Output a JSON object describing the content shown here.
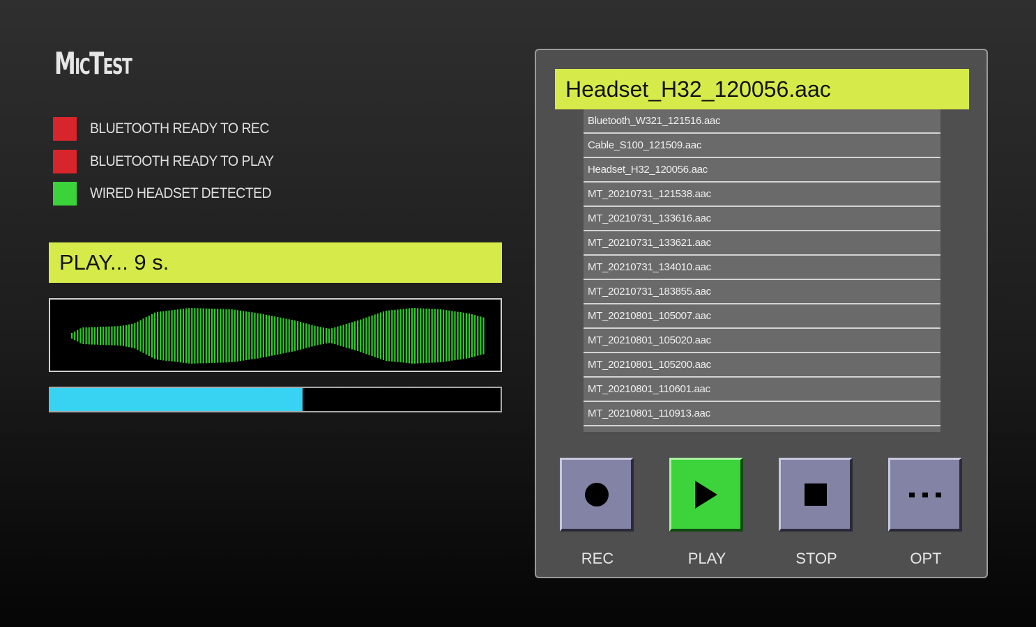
{
  "app": {
    "title": "MicTest"
  },
  "status_indicators": [
    {
      "label": "BLUETOOTH READY TO REC",
      "color": "#d8242b"
    },
    {
      "label": "BLUETOOTH READY TO PLAY",
      "color": "#d8242b"
    },
    {
      "label": "WIRED HEADSET DETECTED",
      "color": "#3bd23a"
    }
  ],
  "status": {
    "text": "PLAY... 9 s."
  },
  "waveform": {
    "color": "#2ecb2a"
  },
  "progress": {
    "value": 0.56,
    "color": "#38d2f3"
  },
  "files": {
    "selected": "Headset_H32_120056.aac",
    "items": [
      "Bluetooth_W321_121516.aac",
      "Cable_S100_121509.aac",
      "Headset_H32_120056.aac",
      "MT_20210731_121538.aac",
      "MT_20210731_133616.aac",
      "MT_20210731_133621.aac",
      "MT_20210731_134010.aac",
      "MT_20210731_183855.aac",
      "MT_20210801_105007.aac",
      "MT_20210801_105020.aac",
      "MT_20210801_105200.aac",
      "MT_20210801_110601.aac",
      "MT_20210801_110913.aac"
    ]
  },
  "controls": [
    {
      "id": "rec",
      "label": "REC",
      "icon": "record-icon",
      "active": false
    },
    {
      "id": "play",
      "label": "PLAY",
      "icon": "play-icon",
      "active": true
    },
    {
      "id": "stop",
      "label": "STOP",
      "icon": "stop-icon",
      "active": false
    },
    {
      "id": "opt",
      "label": "OPT",
      "icon": "more-icon",
      "active": false
    }
  ]
}
